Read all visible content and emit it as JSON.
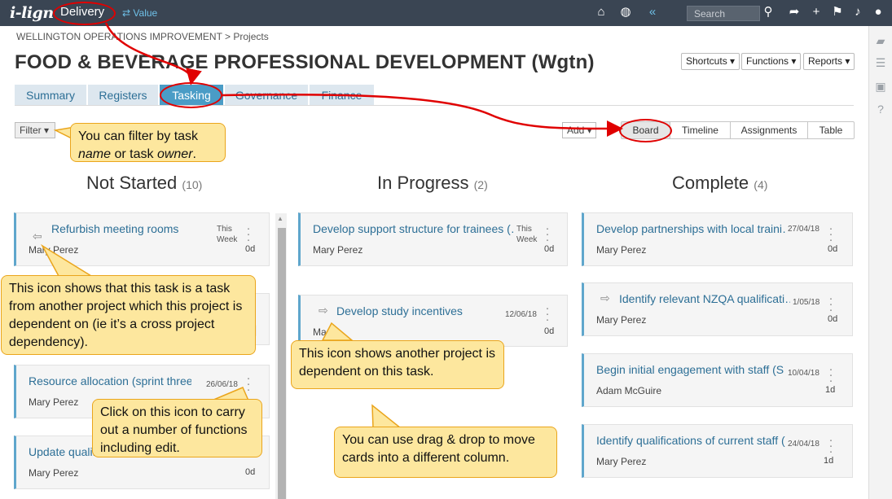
{
  "app": {
    "logo": "i-lign",
    "module": "Delivery",
    "switch_label": "Value",
    "search_placeholder": "Search"
  },
  "icons": {
    "home": "home-icon",
    "globe": "globe-icon",
    "search": "search-icon",
    "share": "share-icon",
    "add": "plus-icon",
    "bookmark": "bookmark-icon",
    "bell": "bell-icon",
    "user": "user-icon",
    "side": [
      "comment-icon",
      "list-icon",
      "lock-icon",
      "help-icon"
    ]
  },
  "page": {
    "breadcrumb": "WELLINGTON OPERATIONS IMPROVEMENT > Projects",
    "title": "FOOD & BEVERAGE PROFESSIONAL DEVELOPMENT (Wgtn)",
    "buttons": [
      "Shortcuts ▾",
      "Functions ▾",
      "Reports ▾"
    ],
    "tabs": [
      "Summary",
      "Registers",
      "Tasking",
      "Governance",
      "Finance"
    ],
    "active_tab": "Tasking",
    "filter_label": "Filter ▾",
    "add_label": "Add ▾",
    "views": [
      "Board",
      "Timeline",
      "Assignments",
      "Table"
    ],
    "active_view": "Board"
  },
  "board": {
    "columns": [
      {
        "title": "Not Started",
        "count": "(10)",
        "cards": [
          {
            "name": "Refurbish meeting rooms",
            "owner": "Mary Perez",
            "due": "This Week",
            "duration": "0d",
            "dependency": "incoming"
          },
          {
            "name": "",
            "owner": "",
            "due": "",
            "duration": "",
            "dependency": ""
          },
          {
            "name": "Resource allocation (sprint three)",
            "owner": "Mary Perez",
            "due": "26/06/18",
            "duration": "",
            "dependency": ""
          },
          {
            "name": "Update qualif",
            "owner": "Mary Perez",
            "due": "",
            "duration": "0d",
            "dependency": ""
          }
        ]
      },
      {
        "title": "In Progress",
        "count": "(2)",
        "cards": [
          {
            "name": "Develop support structure for trainees (…",
            "owner": "Mary Perez",
            "due": "This Week",
            "duration": "0d",
            "dependency": ""
          },
          {
            "name": "Develop study incentives",
            "owner": "Ma",
            "due": "12/06/18",
            "duration": "0d",
            "dependency": "outgoing"
          }
        ]
      },
      {
        "title": "Complete",
        "count": "(4)",
        "cards": [
          {
            "name": "Develop partnerships with local traini…",
            "owner": "Mary Perez",
            "due": "27/04/18",
            "duration": "0d",
            "dependency": ""
          },
          {
            "name": "Identify relevant NZQA qualificati…",
            "owner": "Mary Perez",
            "due": "1/05/18",
            "duration": "0d",
            "dependency": "outgoing"
          },
          {
            "name": "Begin initial engagement with staff (S…",
            "owner": "Adam McGuire",
            "due": "10/04/18",
            "duration": "1d",
            "dependency": ""
          },
          {
            "name": "Identify qualifications of current staff (…",
            "owner": "Mary Perez",
            "due": "24/04/18",
            "duration": "1d",
            "dependency": ""
          }
        ]
      }
    ]
  },
  "callouts": {
    "filter": {
      "pre": "You can filter by task ",
      "name": "name",
      "mid": " or task ",
      "owner": "owner",
      "post": "."
    },
    "incoming": "This icon shows that this task is a task from another project which this project is dependent on (ie it’s a cross project dependency).",
    "outgoing": "This icon shows another project is dependent on this task.",
    "menu": "Click on this icon to carry out a number of functions including edit.",
    "drag": "You can use drag & drop to move cards into a different column."
  },
  "colors": {
    "topbar": "#3a4553",
    "accent": "#4a9cc6",
    "callout": "#fde79e",
    "annotation": "#e00000"
  }
}
